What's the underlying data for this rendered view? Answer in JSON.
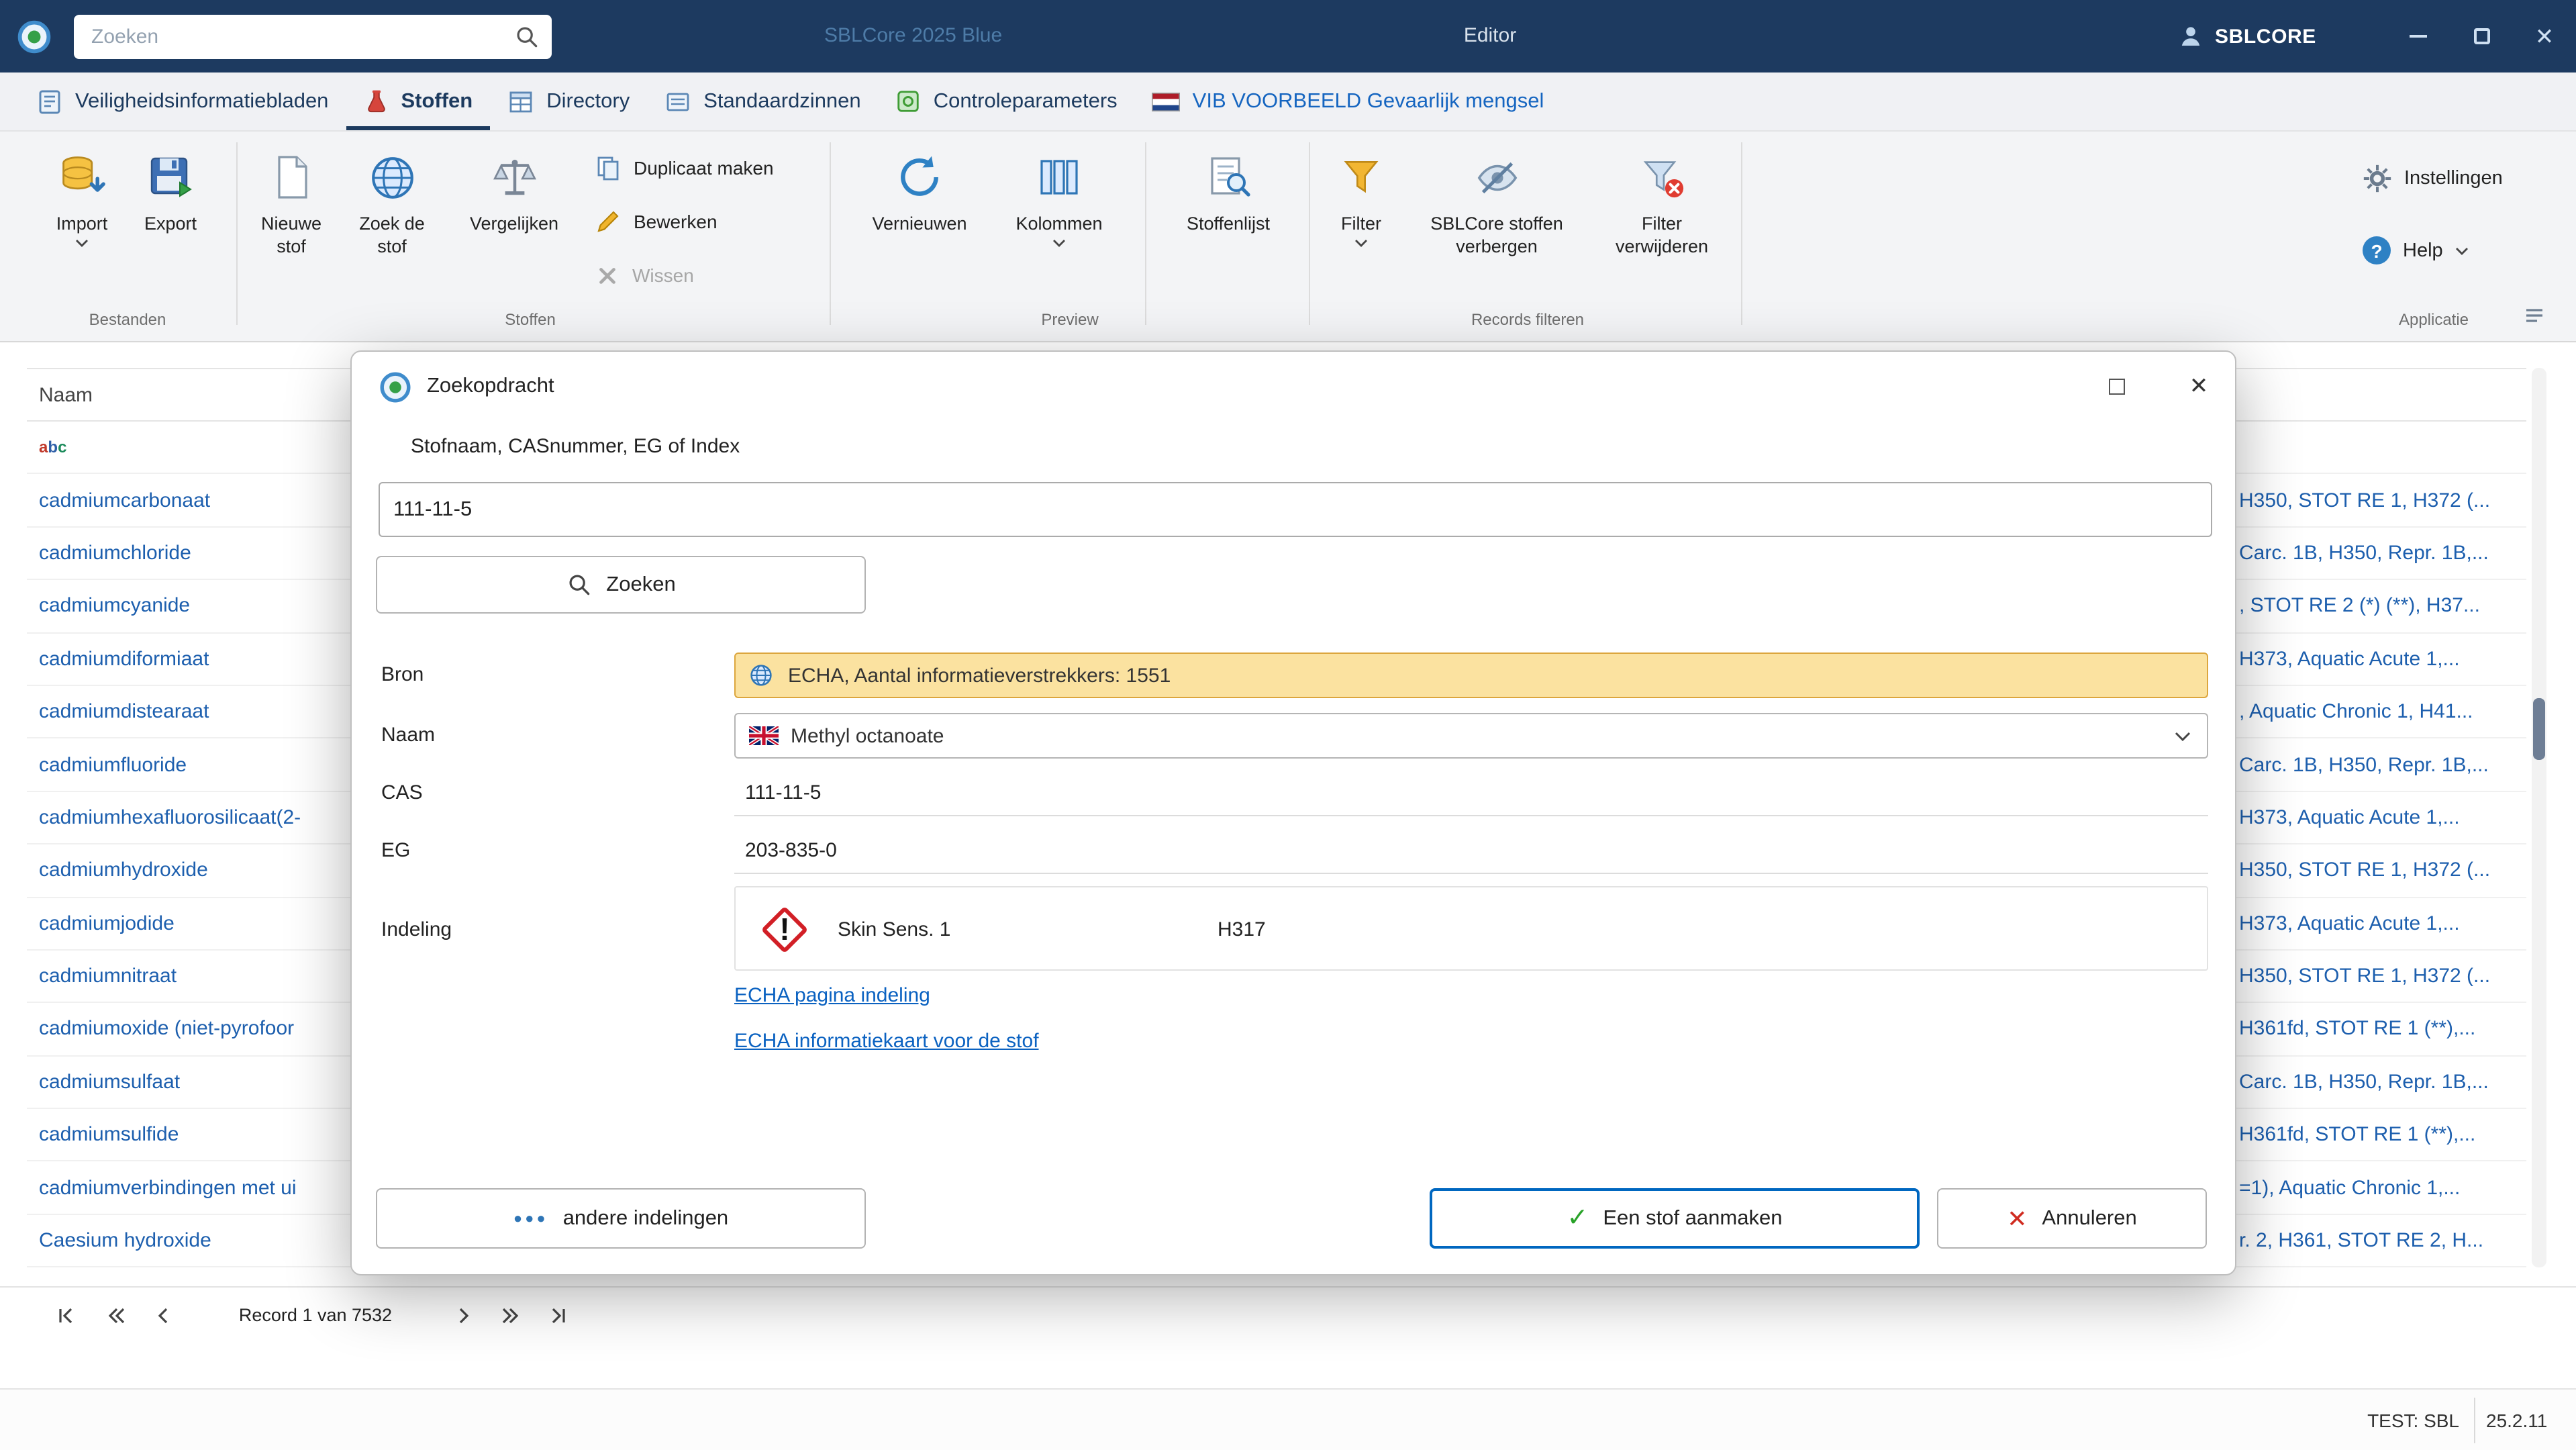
{
  "colors": {
    "titlebar_bg": "#1d3a60",
    "accent_blue": "#0067c0",
    "link_blue": "#0b62c1",
    "row_link_blue": "#1d5fae",
    "bron_highlight_bg": "#fbe2a0",
    "bron_highlight_border": "#dca63e",
    "ghs_red": "#d21f26",
    "active_tab": "#1c3a5e"
  },
  "titlebar": {
    "search_placeholder": "Zoeken",
    "app_title": "SBLCore 2025 Blue",
    "window_title": "Editor",
    "user_label": "SBLCORE"
  },
  "tabs": [
    {
      "label": "Veiligheidsinformatiebladen"
    },
    {
      "label": "Stoffen"
    },
    {
      "label": "Directory"
    },
    {
      "label": "Standaardzinnen"
    },
    {
      "label": "Controleparameters"
    },
    {
      "label": "VIB VOORBEELD Gevaarlijk mengsel"
    }
  ],
  "ribbon": {
    "import": "Import",
    "export": "Export",
    "nieuwe_stof": "Nieuwe stof",
    "zoek_de_stof": "Zoek de stof",
    "vergelijken": "Vergelijken",
    "duplicaat_maken": "Duplicaat maken",
    "bewerken": "Bewerken",
    "wissen": "Wissen",
    "vernieuwen": "Vernieuwen",
    "kolommen": "Kolommen",
    "stoffenlijst": "Stoffenlijst",
    "filter": "Filter",
    "sblcore_stoffen_verbergen": "SBLCore stoffen verbergen",
    "filter_verwijderen": "Filter verwijderen",
    "instellingen": "Instellingen",
    "help": "Help",
    "groups": {
      "bestanden": "Bestanden",
      "stoffen": "Stoffen",
      "preview": "Preview",
      "records_filteren": "Records filteren",
      "applicatie": "Applicatie"
    }
  },
  "table": {
    "header_naam": "Naam",
    "rows": [
      {
        "name": "cadmiumcarbonaat",
        "classification": "H350, STOT RE 1, H372 (..."
      },
      {
        "name": "cadmiumchloride",
        "classification": "Carc. 1B, H350, Repr. 1B,..."
      },
      {
        "name": "cadmiumcyanide",
        "classification": ", STOT RE 2 (*) (**), H37..."
      },
      {
        "name": "cadmiumdiformiaat",
        "classification": "H373, Aquatic Acute 1,..."
      },
      {
        "name": "cadmiumdistearaat",
        "classification": ", Aquatic Chronic 1, H41..."
      },
      {
        "name": "cadmiumfluoride",
        "classification": "Carc. 1B, H350, Repr. 1B,..."
      },
      {
        "name": "cadmiumhexafluorosilicaat(2-",
        "classification": "H373, Aquatic Acute 1,..."
      },
      {
        "name": "cadmiumhydroxide",
        "classification": "H350, STOT RE 1, H372 (..."
      },
      {
        "name": "cadmiumjodide",
        "classification": "H373, Aquatic Acute 1,..."
      },
      {
        "name": "cadmiumnitraat",
        "classification": "H350, STOT RE 1, H372 (..."
      },
      {
        "name": "cadmiumoxide (niet-pyrofoor",
        "classification": "H361fd, STOT RE 1 (**),..."
      },
      {
        "name": "cadmiumsulfaat",
        "classification": "Carc. 1B, H350, Repr. 1B,..."
      },
      {
        "name": "cadmiumsulfide",
        "classification": "H361fd, STOT RE 1 (**),..."
      },
      {
        "name": "cadmiumverbindingen met ui",
        "classification": "=1), Aquatic Chronic 1,..."
      },
      {
        "name": "Caesium hydroxide",
        "classification": "r. 2, H361, STOT RE 2, H..."
      }
    ]
  },
  "dialog": {
    "title": "Zoekopdracht",
    "query_label": "Stofnaam, CASnummer, EG of Index",
    "query_value": "111-11-5",
    "search_button": "Zoeken",
    "bron_label": "Bron",
    "bron_value": "ECHA, Aantal informatieverstrekkers: 1551",
    "naam_label": "Naam",
    "naam_value": "Methyl octanoate",
    "cas_label": "CAS",
    "cas_value": "111-11-5",
    "eg_label": "EG",
    "eg_value": "203-835-0",
    "indeling_label": "Indeling",
    "classification_name": "Skin Sens. 1",
    "classification_code": "H317",
    "link_echa_indeling": "ECHA pagina indeling",
    "link_echa_infokaart": "ECHA informatiekaart voor de stof",
    "btn_andere_indelingen": "andere indelingen",
    "btn_stof_aanmaken": "Een stof aanmaken",
    "btn_annuleren": "Annuleren"
  },
  "recordnav": {
    "label": "Record 1 van 7532"
  },
  "statusbar": {
    "environment": "TEST: SBL",
    "version": "25.2.11"
  }
}
